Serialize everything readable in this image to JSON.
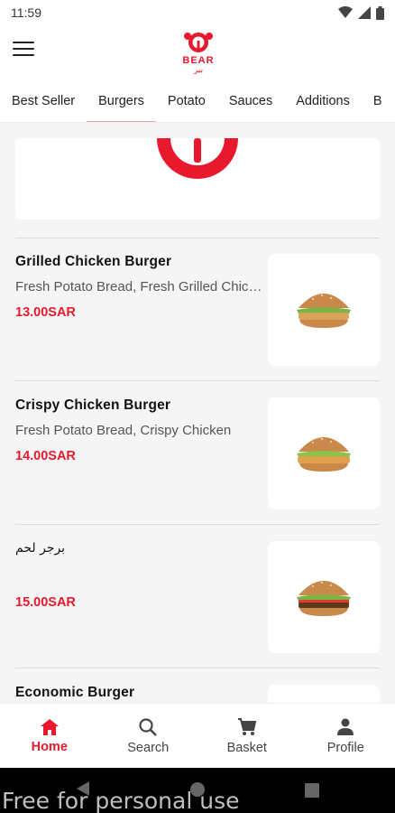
{
  "status": {
    "time": "11:59"
  },
  "header": {
    "logo_text": "BEAR",
    "logo_arabic": "بير"
  },
  "tabs": [
    {
      "label": "Best Seller"
    },
    {
      "label": "Burgers"
    },
    {
      "label": "Potato"
    },
    {
      "label": "Sauces"
    },
    {
      "label": "Additions"
    },
    {
      "label": "B"
    }
  ],
  "active_tab": "Burgers",
  "items": [
    {
      "name": "Grilled Chicken Burger",
      "description": "Fresh Potato Bread, Fresh Grilled Chicken",
      "price": "13.00SAR"
    },
    {
      "name": "Crispy Chicken Burger",
      "description": "Fresh Potato Bread, Crispy Chicken",
      "price": "14.00SAR"
    },
    {
      "name": "برجر لحم",
      "description": "",
      "price": "15.00SAR"
    },
    {
      "name": "Economic Burger",
      "description": "",
      "price": ""
    }
  ],
  "bottom_nav": [
    {
      "label": "Home",
      "icon": "home-icon"
    },
    {
      "label": "Search",
      "icon": "search-icon"
    },
    {
      "label": "Basket",
      "icon": "cart-icon"
    },
    {
      "label": "Profile",
      "icon": "profile-icon"
    }
  ],
  "watermark": "Free for personal use",
  "colors": {
    "accent": "#e8192c",
    "tab_indicator": "#e8a8ad"
  }
}
